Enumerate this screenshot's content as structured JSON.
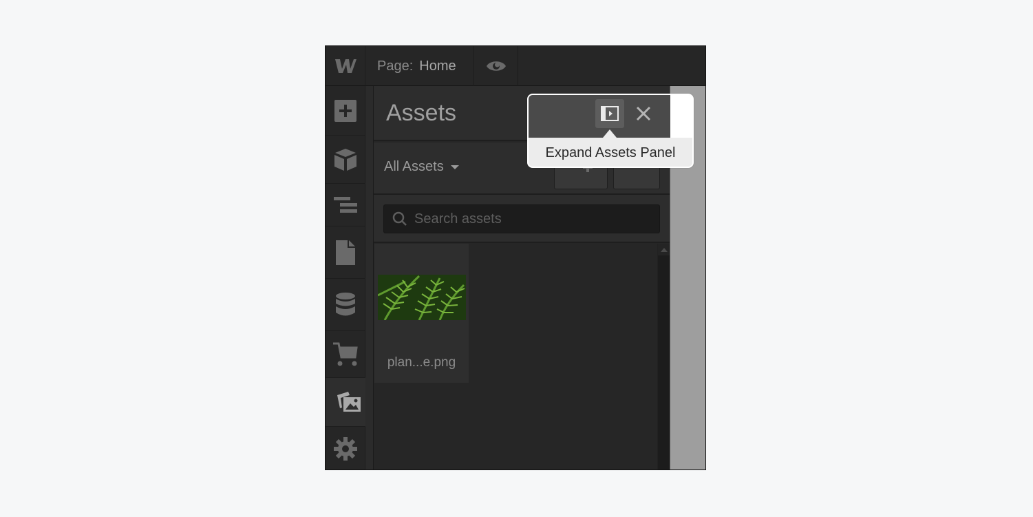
{
  "topbar": {
    "logo": "W",
    "page_label": "Page:",
    "page_value": "Home",
    "preview_icon": "eye-icon"
  },
  "leftbar": {
    "items": [
      {
        "name": "add",
        "icon": "plus-square-icon",
        "active": false
      },
      {
        "name": "components",
        "icon": "cube-icon",
        "active": false
      },
      {
        "name": "navigator",
        "icon": "navigator-icon",
        "active": false
      },
      {
        "name": "pages",
        "icon": "page-icon",
        "active": false
      },
      {
        "name": "cms",
        "icon": "database-icon",
        "active": false
      },
      {
        "name": "ecommerce",
        "icon": "cart-icon",
        "active": false
      },
      {
        "name": "assets",
        "icon": "images-icon",
        "active": true
      },
      {
        "name": "settings",
        "icon": "gear-icon",
        "active": false
      }
    ]
  },
  "panel": {
    "title": "Assets",
    "filter_label": "All Assets",
    "search_placeholder": "Search assets",
    "assets": [
      {
        "name": "plan...e.png"
      }
    ]
  },
  "popup": {
    "tooltip": "Expand Assets Panel"
  },
  "colors": {
    "background": "#f6f7f8",
    "ui_dark": "#262626",
    "canvas": "#9e9e9e"
  }
}
